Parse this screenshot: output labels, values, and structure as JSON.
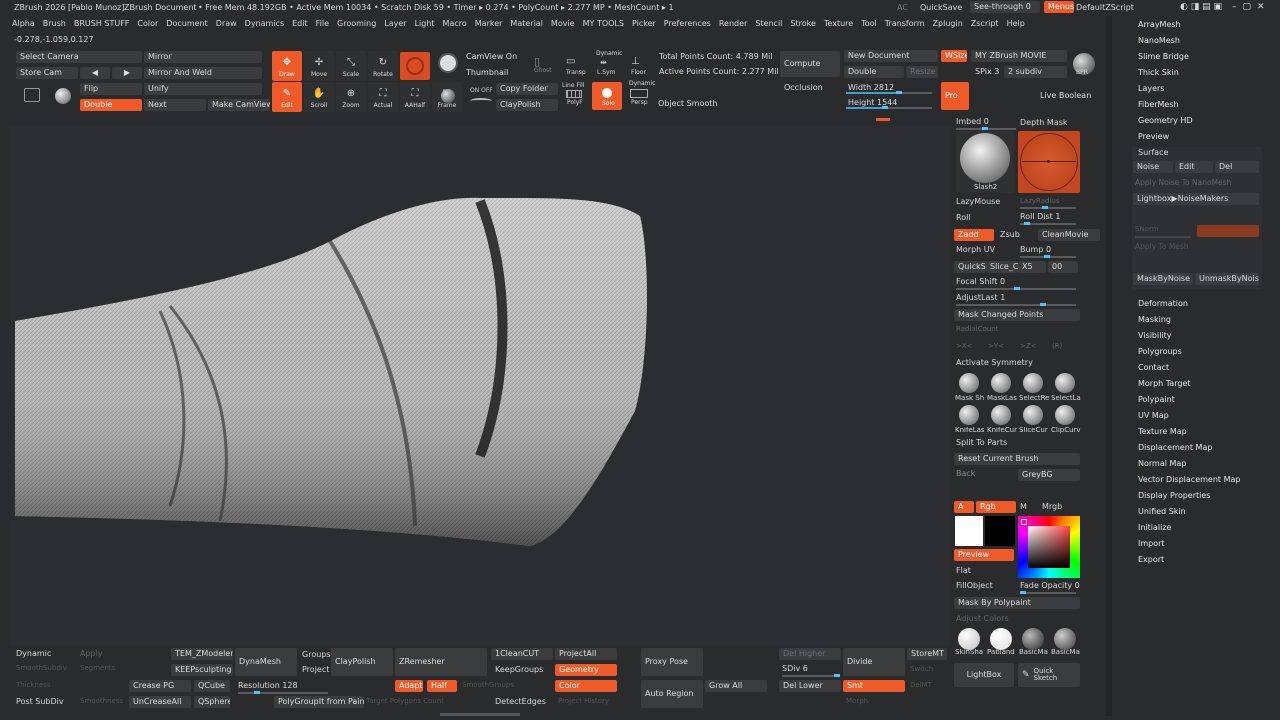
{
  "title": {
    "app": "ZBrush 2026 [Pablo Munoz]",
    "doc": "ZBrush Document",
    "stats": "• Free Mem 48.192GB • Active Mem 10034 • Scratch Disk 59 • Timer ▸ 0.274 • PolyCount ▸ 2.277 MP • MeshCount ▸ 1",
    "ac": "AC",
    "quicksave": "QuickSave",
    "seethrough": "See-through 0",
    "menus": "Menus",
    "zscript": "DefaultZScript"
  },
  "menubar": [
    "Alpha",
    "Brush",
    "BRUSH STUFF",
    "Color",
    "Document",
    "Draw",
    "Dynamics",
    "Edit",
    "File",
    "Grooming",
    "Layer",
    "Light",
    "Macro",
    "Marker",
    "Material",
    "Movie",
    "MY TOOLS",
    "Picker",
    "Preferences",
    "Render",
    "Stencil",
    "Stroke",
    "Texture",
    "Tool",
    "Transform",
    "Zplugin",
    "Zscript",
    "Help"
  ],
  "coords": "-0.278,-1.059,0.127",
  "top": {
    "select_camera": "Select Camera",
    "mirror": "Mirror",
    "store_cam": "Store Cam",
    "mirror_weld": "Mirror And Weld",
    "flip": "Flip",
    "unify": "Unify",
    "double": "Double",
    "next": "Next",
    "make_camview": "Make CamView",
    "camview_on": "CamView On",
    "thumbnail": "Thumbnail",
    "copy_folder": "Copy Folder",
    "claypolish": "ClayPolish",
    "object_smooth": "Object Smooth",
    "total_points": "Total Points Count: 4.789 Mil",
    "active_points": "Active Points Count: 2.277 Mil",
    "compute": "Compute",
    "occlusion": "Occlusion",
    "new_document": "New Document",
    "wsize": "WSize",
    "my_movie": "MY ZBrush MOVIE",
    "double2": "Double",
    "resize": "Resize",
    "spix": "SPix 3",
    "subdiv": "2 subdiv",
    "width": "Width 2812",
    "height": "Height 1544",
    "pro": "Pro",
    "bpr": "BPR",
    "live_boolean": "Live Boolean"
  },
  "tools": [
    {
      "name": "draw-tool",
      "label": "Draw",
      "icon": "✥",
      "active": true
    },
    {
      "name": "move-tool",
      "label": "Move",
      "icon": "✢",
      "active": false
    },
    {
      "name": "scale-tool",
      "label": "Scale",
      "icon": "⤡",
      "active": false
    },
    {
      "name": "rotate-tool",
      "label": "Rotate",
      "icon": "↻",
      "active": false
    },
    {
      "name": "edit-tool",
      "label": "Edit",
      "icon": "✎",
      "active": true
    },
    {
      "name": "scroll-tool",
      "label": "Scroll",
      "icon": "✋",
      "active": false
    },
    {
      "name": "zoom-tool",
      "label": "Zoom",
      "icon": "⊕",
      "active": false
    },
    {
      "name": "actual-tool",
      "label": "Actual",
      "icon": "⛶",
      "active": false
    },
    {
      "name": "aahalf-tool",
      "label": "AAHalf",
      "icon": "⛶",
      "active": false
    },
    {
      "name": "frame-tool",
      "label": "Frame",
      "icon": "▣",
      "active": false
    }
  ],
  "smalltools": {
    "ghost": "Ghost",
    "transp": "Transp",
    "dynamic": "Dynamic",
    "lsym": "L.Sym",
    "floor": "Floor",
    "linefill": "Line Fill",
    "polyf": "PolyF",
    "solo": "Solo",
    "persp": "Persp",
    "onoff": "ON OFF"
  },
  "brushpanel": {
    "imbed": "Imbed 0",
    "depth_mask": "Depth Mask",
    "brush_name": "Slash2",
    "lazymouse": "LazyMouse",
    "lazyradius": "LazyRadius",
    "roll": "Roll",
    "roll_dist": "Roll Dist 1",
    "zadd": "Zadd",
    "zsub": "Zsub",
    "cleanmovie": "CleanMovie",
    "morph_uv": "Morph UV",
    "bump": "Bump 0",
    "quicksc": "QuickSc",
    "slice": "Slice_Cu",
    "x5": "X5",
    "zero": "00",
    "focal_shift": "Focal Shift 0",
    "adjustlast": "AdjustLast 1",
    "mask_changed": "Mask Changed Points",
    "radialcount": "RadialCount",
    "sym_x": ">X<",
    "sym_y": ">Y<",
    "sym_z": ">Z<",
    "sym_r": "(R)",
    "activate_symmetry": "Activate Symmetry",
    "icons1": [
      "Mask Sh",
      "MaskLas",
      "SelectRe",
      "SelectLa"
    ],
    "icons2": [
      "KnifeLas",
      "KnifeCur",
      "SliceCur",
      "ClipCurv"
    ],
    "split_parts": "Split To Parts",
    "reset_brush": "Reset Current Brush",
    "back": "Back",
    "greybg": "GreyBG",
    "a": "A",
    "rgb": "Rgb",
    "m": "M",
    "mrgb": "Mrgb",
    "preview": "Preview",
    "flat": "Flat",
    "fillobject": "FillObject",
    "fade_opacity": "Fade Opacity 0",
    "mask_polypaint": "Mask By Polypaint",
    "adjust_colors": "Adjust Colors",
    "materials": [
      "SkinSha",
      "Pabland",
      "BasicMa",
      "BasicMa"
    ],
    "lightbox": "LightBox",
    "quick_sketch": "Quick Sketch"
  },
  "rightmenu": {
    "top": [
      "ArrayMesh",
      "NanoMesh",
      "Slime Bridge",
      "Thick Skin",
      "Layers",
      "FiberMesh",
      "Geometry HD",
      "Preview",
      "Surface"
    ],
    "noise": "Noise",
    "edit": "Edit",
    "del": "Del",
    "apply_noise_nano": "Apply Noise To NanoMesh",
    "lightbox_noise": "Lightbox▶NoiseMakers",
    "snorm": "SNorm",
    "apply_mesh": "Apply To Mesh",
    "maskbynoise": "MaskByNoise",
    "unmaskbynoise": "UnmaskByNoise",
    "bottom": [
      "Deformation",
      "Masking",
      "Visibility",
      "Polygroups",
      "Contact",
      "Morph Target",
      "Polypaint",
      "UV Map",
      "Texture Map",
      "Displacement Map",
      "Normal Map",
      "Vector Displacement Map",
      "Display Properties",
      "Unified Skin",
      "Initialize",
      "Import",
      "Export"
    ]
  },
  "bottom": {
    "dynamic": "Dynamic",
    "apply": "Apply",
    "smoothsubdiv": "SmoothSubdiv",
    "segments": "Segments",
    "thickness": "Thickness",
    "crease_pg": "Crease PG",
    "qcube": "QCube",
    "post_subdiv": "Post SubDiv",
    "smoothness": "Smoothness",
    "uncreaseall": "UnCreaseAll",
    "qsphere": "QSphere",
    "tem_zmodeler": "TEM_ZModeler",
    "keepsculpting": "KEEPsculpting",
    "dynamesh": "DynaMesh",
    "groups": "Groups",
    "project": "Project",
    "claypolish": "ClayPolish",
    "resolution": "Resolution 128",
    "polygroupit": "PolyGroupIt from Paint",
    "zremesher": "ZRemesher",
    "adapt": "Adapt",
    "half": "Half",
    "smoothgroups": "SmoothGroups",
    "target_poly": "Target Polygons Count",
    "cleancut": "1CleanCUT",
    "keepgroups": "KeepGroups",
    "detectedges": "DetectEdges",
    "projectall": "ProjectAll",
    "geometry": "Geometry",
    "color": "Color",
    "project_history": "Project History",
    "proxy_pose": "Proxy Pose",
    "auto_region": "Auto Region",
    "grow_all": "Grow All",
    "del_higher": "Del Higher",
    "sdiv": "SDiv 6",
    "del_lower": "Del Lower",
    "divide": "Divide",
    "smt": "Smt",
    "morph": "Morph",
    "storemt": "StoreMT",
    "switch": "Switch",
    "delmt": "DelMT"
  }
}
